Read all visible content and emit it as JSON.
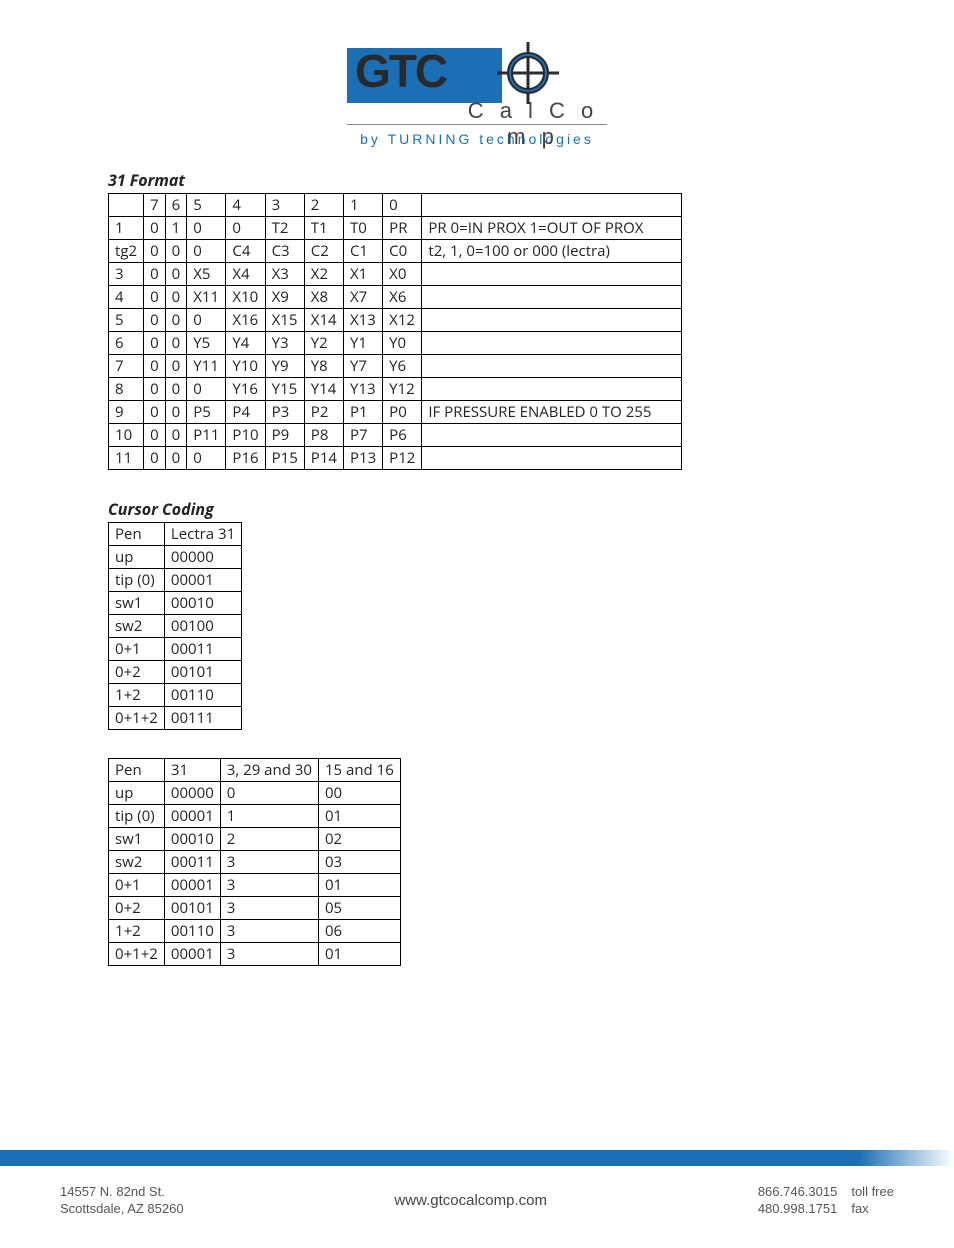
{
  "header": {
    "logo_text": "GTC",
    "calcomp": "C a l C o m p",
    "byline": "by  TURNING  technologies"
  },
  "section1_title": "31 Format",
  "table1": {
    "rows": [
      [
        "",
        "7",
        "6",
        "5",
        "4",
        "3",
        "2",
        "1",
        "0",
        ""
      ],
      [
        "1",
        "0",
        "1",
        "0",
        "0",
        "T2",
        "T1",
        "T0",
        "PR",
        "PR 0=IN PROX 1=OUT OF PROX"
      ],
      [
        "tg2",
        "0",
        "0",
        "0",
        "C4",
        "C3",
        "C2",
        "C1",
        "C0",
        "t2, 1, 0=100 or 000 (lectra)"
      ],
      [
        "3",
        "0",
        "0",
        "X5",
        "X4",
        "X3",
        "X2",
        "X1",
        "X0",
        ""
      ],
      [
        "4",
        "0",
        "0",
        "X11",
        "X10",
        "X9",
        "X8",
        "X7",
        "X6",
        ""
      ],
      [
        "5",
        "0",
        "0",
        "0",
        "X16",
        "X15",
        "X14",
        "X13",
        "X12",
        ""
      ],
      [
        "6",
        "0",
        "0",
        "Y5",
        "Y4",
        "Y3",
        "Y2",
        "Y1",
        "Y0",
        ""
      ],
      [
        "7",
        "0",
        "0",
        "Y11",
        "Y10",
        "Y9",
        "Y8",
        "Y7",
        "Y6",
        ""
      ],
      [
        "8",
        "0",
        "0",
        "0",
        "Y16",
        "Y15",
        "Y14",
        "Y13",
        "Y12",
        ""
      ],
      [
        "9",
        "0",
        "0",
        "P5",
        "P4",
        "P3",
        "P2",
        "P1",
        "P0",
        "IF PRESSURE ENABLED 0 TO 255"
      ],
      [
        "10",
        "0",
        "0",
        "P11",
        "P10",
        "P9",
        "P8",
        "P7",
        "P6",
        ""
      ],
      [
        "11",
        "0",
        "0",
        "0",
        "P16",
        "P15",
        "P14",
        "P13",
        "P12",
        ""
      ]
    ]
  },
  "section2_title": "Cursor Coding",
  "table2": {
    "rows": [
      [
        "Pen",
        "Lectra 31"
      ],
      [
        "up",
        "00000"
      ],
      [
        "tip (0)",
        "00001"
      ],
      [
        "sw1",
        "00010"
      ],
      [
        "sw2",
        "00100"
      ],
      [
        "0+1",
        "00011"
      ],
      [
        "0+2",
        "00101"
      ],
      [
        "1+2",
        "00110"
      ],
      [
        "0+1+2",
        "00111"
      ]
    ]
  },
  "table3": {
    "rows": [
      [
        "Pen",
        "31",
        "3, 29 and 30",
        "15 and 16"
      ],
      [
        "up",
        "00000",
        "0",
        "00"
      ],
      [
        "tip (0)",
        "00001",
        "1",
        "01"
      ],
      [
        "sw1",
        "00010",
        "2",
        "02"
      ],
      [
        "sw2",
        "00011",
        "3",
        "03"
      ],
      [
        "0+1",
        "00001",
        "3",
        "01"
      ],
      [
        "0+2",
        "00101",
        "3",
        "05"
      ],
      [
        "1+2",
        "00110",
        "3",
        "06"
      ],
      [
        "0+1+2",
        "00001",
        "3",
        "01"
      ]
    ]
  },
  "footer": {
    "addr1": "14557 N. 82nd St.",
    "addr2": "Scottsdale, AZ 85260",
    "url": "www.gtcocalcomp.com",
    "phone1": "866.746.3015",
    "phone1_label": "toll free",
    "phone2": "480.998.1751",
    "phone2_label": "fax"
  }
}
